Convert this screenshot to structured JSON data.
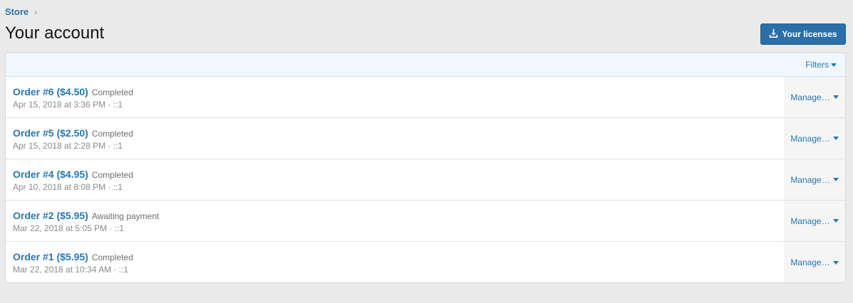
{
  "breadcrumb": {
    "store": "Store",
    "separator": "›"
  },
  "page_title": "Your account",
  "licenses_button": {
    "label": "Your licenses",
    "icon": "download-icon"
  },
  "filters": {
    "label": "Filters"
  },
  "orders": [
    {
      "title": "Order #6 ($4.50)",
      "status": "Completed",
      "meta": "Apr 15, 2018 at 3:36 PM · ::1",
      "action": "Manage…"
    },
    {
      "title": "Order #5 ($2.50)",
      "status": "Completed",
      "meta": "Apr 15, 2018 at 2:28 PM · ::1",
      "action": "Manage…"
    },
    {
      "title": "Order #4 ($4.95)",
      "status": "Completed",
      "meta": "Apr 10, 2018 at 8:08 PM · ::1",
      "action": "Manage…"
    },
    {
      "title": "Order #2 ($5.95)",
      "status": "Awaiting payment",
      "meta": "Mar 22, 2018 at 5:05 PM · ::1",
      "action": "Manage…"
    },
    {
      "title": "Order #1 ($5.95)",
      "status": "Completed",
      "meta": "Mar 22, 2018 at 10:34 AM · ::1",
      "action": "Manage…"
    }
  ],
  "colors": {
    "accent": "#2577b1",
    "button_bg": "#2a6fa8",
    "page_bg": "#eaeaea"
  }
}
